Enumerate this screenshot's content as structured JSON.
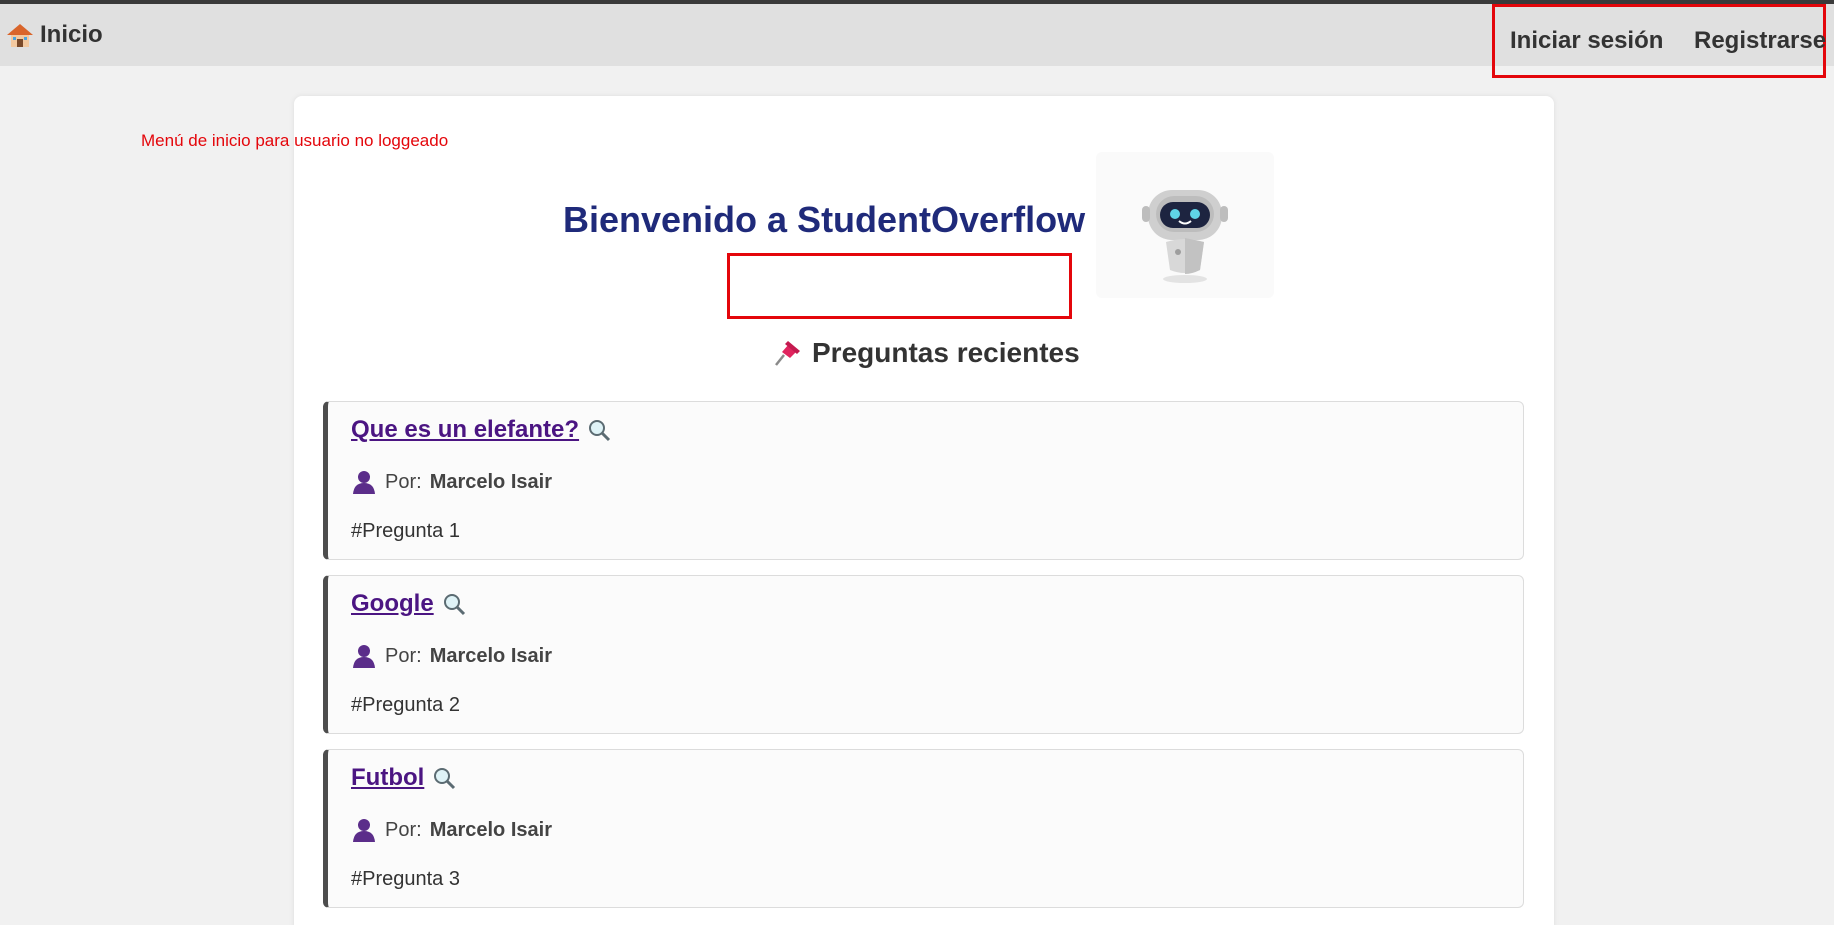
{
  "navbar": {
    "home_label": "Inicio",
    "login_label": "Iniciar sesión",
    "register_label": "Registrarse"
  },
  "annotation": "Menú de inicio para usuario no loggeado",
  "welcome_title": "Bienvenido a StudentOverflow",
  "recent_heading": "Preguntas recientes",
  "questions": [
    {
      "title": "Que es un elefante?",
      "by_label": "Por:",
      "author": "Marcelo Isair",
      "tag": "#Pregunta 1"
    },
    {
      "title": "Google",
      "by_label": "Por:",
      "author": "Marcelo Isair",
      "tag": "#Pregunta 2"
    },
    {
      "title": "Futbol",
      "by_label": "Por:",
      "author": "Marcelo Isair",
      "tag": "#Pregunta 3"
    }
  ],
  "colors": {
    "accent_red": "#e4060b",
    "title_navy": "#1f2a7a",
    "link_purple": "#4b1582"
  },
  "icons": [
    "house-icon",
    "robot-icon",
    "pin-icon",
    "magnifier-icon",
    "person-icon"
  ]
}
